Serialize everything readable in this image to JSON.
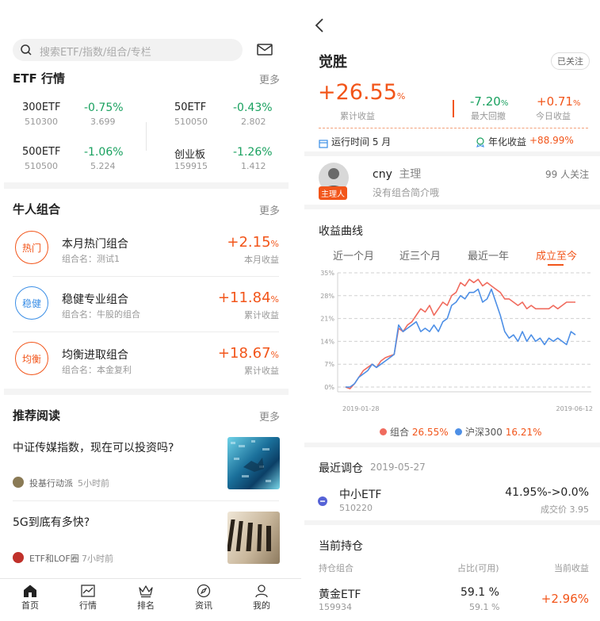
{
  "left": {
    "search": {
      "placeholder": "搜索ETF/指数/组合/专栏"
    },
    "etf_section": {
      "title": "ETF 行情",
      "more": "更多",
      "items": [
        {
          "name": "300ETF",
          "code": "510300",
          "change": "-0.75%",
          "price": "3.699"
        },
        {
          "name": "50ETF",
          "code": "510050",
          "change": "-0.43%",
          "price": "2.802"
        },
        {
          "name": "500ETF",
          "code": "510500",
          "change": "-1.06%",
          "price": "5.224"
        },
        {
          "name": "创业板",
          "code": "159915",
          "change": "-1.26%",
          "price": "1.412"
        }
      ]
    },
    "portfolio_section": {
      "title": "牛人组合",
      "more": "更多",
      "items": [
        {
          "badge": "热门",
          "title": "本月热门组合",
          "sub": "组合名：测试1",
          "value": "+2.15",
          "pct": "%",
          "value_label": "本月收益",
          "color": "#f2551a"
        },
        {
          "badge": "稳健",
          "title": "稳健专业组合",
          "sub": "组合名：牛股的组合",
          "value": "+11.84",
          "pct": "%",
          "value_label": "累计收益",
          "color": "#3a8ee6"
        },
        {
          "badge": "均衡",
          "title": "均衡进取组合",
          "sub": "组合名：本金复利",
          "value": "+18.67",
          "pct": "%",
          "value_label": "累计收益",
          "color": "#f2551a"
        }
      ]
    },
    "reading_section": {
      "title": "推荐阅读",
      "more": "更多",
      "articles": [
        {
          "title": "中证传媒指数，现在可以投资吗?",
          "author": "投基行动派",
          "time": "5小时前"
        },
        {
          "title": "5G到底有多快?",
          "author": "ETF和LOF圈",
          "time": "7小时前"
        }
      ]
    },
    "bottom_nav": [
      {
        "label": "首页",
        "icon": "home-icon"
      },
      {
        "label": "行情",
        "icon": "chart-icon"
      },
      {
        "label": "排名",
        "icon": "crown-icon"
      },
      {
        "label": "资讯",
        "icon": "compass-icon"
      },
      {
        "label": "我的",
        "icon": "user-icon"
      }
    ]
  },
  "right": {
    "title": "觉胜",
    "follow_button": "已关注",
    "cumulative": {
      "value": "+26.55",
      "pct": "%",
      "label": "累计收益"
    },
    "max_drawdown": {
      "value": "-7.20",
      "pct": "%",
      "label": "最大回撤"
    },
    "today": {
      "value": "+0.71",
      "pct": "%",
      "label": "今日收益"
    },
    "run_time": "运行时间 5 月",
    "annual_label": "年化收益",
    "annual_value": "+88.99%",
    "manager": {
      "name": "cny",
      "role": "主理",
      "badge": "主理人",
      "followers": "99 人关注",
      "intro": "没有组合简介哦"
    },
    "curve": {
      "title": "收益曲线",
      "tabs": [
        "近一个月",
        "近三个月",
        "最近一年",
        "成立至今"
      ],
      "active_tab": 3
    },
    "legend": [
      {
        "name": "组合",
        "value": "26.55%",
        "color": "#f06b5e"
      },
      {
        "name": "沪深300",
        "value": "16.21%",
        "color": "#4d8fe6"
      }
    ],
    "rebalance": {
      "title": "最近调仓",
      "date": "2019-05-27",
      "name": "中小ETF",
      "code": "510220",
      "change": "41.95%->0.0%",
      "price_label": "成交价 3.95"
    },
    "holdings": {
      "title": "当前持仓",
      "headers": [
        "持仓组合",
        "占比(可用)",
        "当前收益"
      ],
      "rows": [
        {
          "name": "黄金ETF",
          "code": "159934",
          "ratio": "59.1 %",
          "available": "59.1 %",
          "return": "+2.96%"
        }
      ]
    }
  },
  "chart_data": {
    "type": "line",
    "x_start": "2019-01-28",
    "x_end": "2019-06-12",
    "yticks": [
      "35%",
      "28%",
      "21%",
      "14%",
      "7%",
      "0%"
    ],
    "ylim": [
      0,
      35
    ],
    "series": [
      {
        "name": "组合",
        "color": "#f06b5e",
        "values": [
          0,
          -0.5,
          1,
          3,
          5,
          6,
          7,
          6,
          8,
          9,
          9.5,
          10,
          18,
          17,
          19,
          20,
          22,
          24,
          23,
          25,
          22,
          24,
          26,
          25,
          28,
          29,
          32,
          31,
          33,
          32,
          33,
          31,
          32,
          31,
          30,
          29,
          27,
          27,
          26,
          25,
          26,
          24,
          25,
          24,
          24,
          24,
          24,
          25,
          24,
          25,
          26,
          26,
          26
        ]
      },
      {
        "name": "沪深300",
        "color": "#4d8fe6",
        "values": [
          0,
          0,
          1,
          3,
          4,
          5,
          7,
          6,
          7,
          8,
          9,
          10,
          19,
          17,
          18,
          19,
          20,
          17,
          18,
          17,
          19,
          17,
          20,
          21,
          25,
          26,
          28,
          27,
          29,
          29,
          30,
          26,
          27,
          30,
          26,
          22,
          17,
          15,
          16,
          14,
          17,
          14,
          16,
          14,
          15,
          13,
          15,
          14,
          15,
          14,
          13,
          17,
          16
        ]
      }
    ]
  }
}
